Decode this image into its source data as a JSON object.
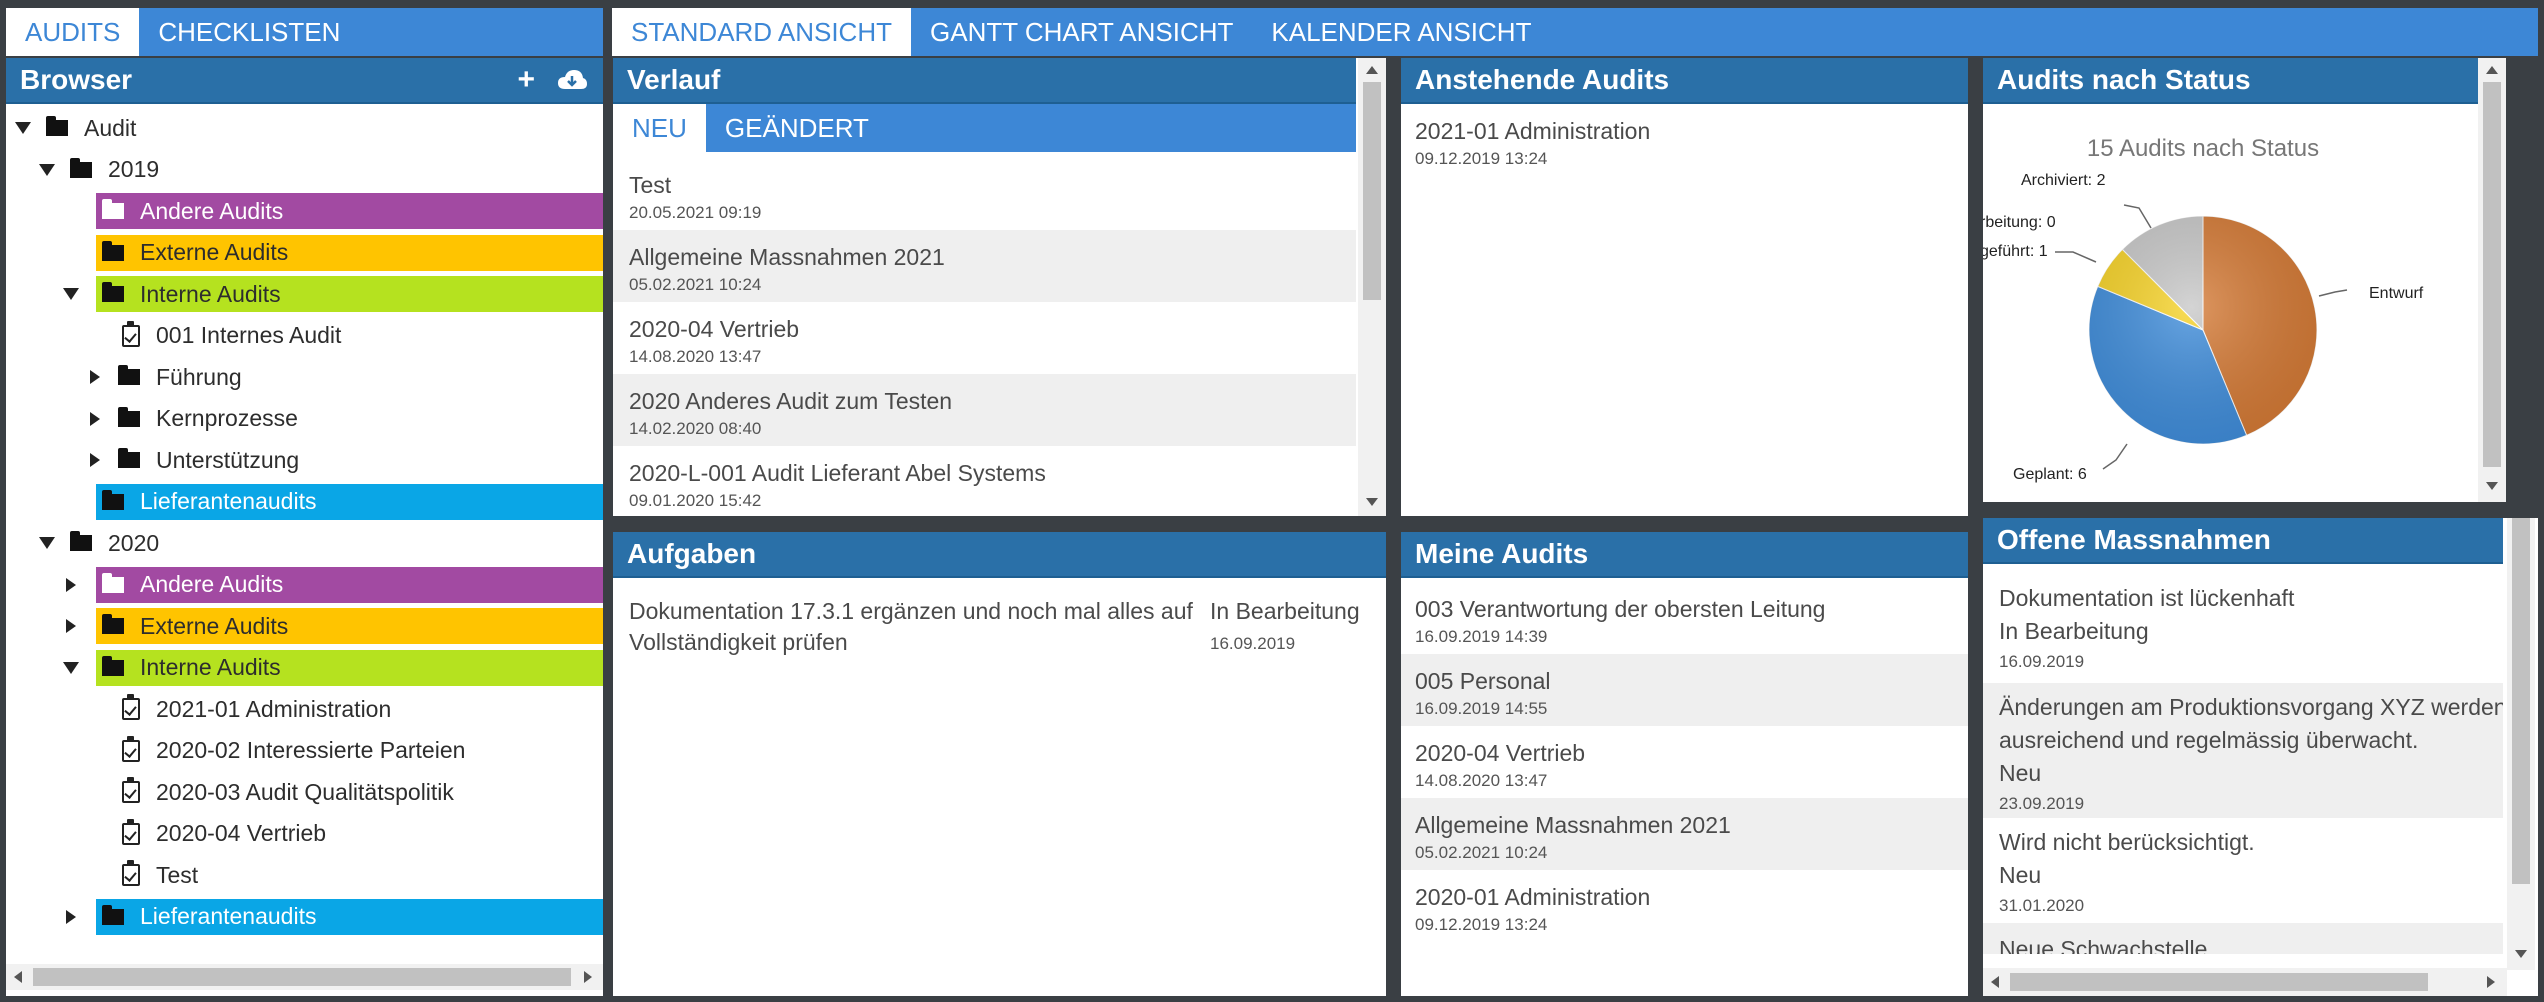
{
  "left_tabs": [
    {
      "label": "AUDITS",
      "active": true
    },
    {
      "label": "CHECKLISTEN",
      "active": false
    }
  ],
  "main_tabs": [
    {
      "label": "STANDARD ANSICHT",
      "active": true
    },
    {
      "label": "GANTT CHART ANSICHT",
      "active": false
    },
    {
      "label": "KALENDER ANSICHT",
      "active": false
    }
  ],
  "browser": {
    "title": "Browser",
    "add_icon": "+",
    "tree": [
      {
        "label": "Audit",
        "level": 0,
        "expander": "down",
        "type": "folder"
      },
      {
        "label": "2019",
        "level": 1,
        "expander": "down",
        "type": "folder"
      },
      {
        "label": "Andere Audits",
        "level": 2,
        "expander": "none",
        "type": "band",
        "color": "#a24aa2"
      },
      {
        "label": "Externe Audits",
        "level": 2,
        "expander": "none",
        "type": "band",
        "color": "#ffc400"
      },
      {
        "label": "Interne Audits",
        "level": 2,
        "expander": "down",
        "type": "band",
        "color": "#b5e21f"
      },
      {
        "label": "001 Internes Audit",
        "level": 3,
        "expander": "none",
        "type": "audit"
      },
      {
        "label": "Führung",
        "level": 3,
        "expander": "right",
        "type": "folder"
      },
      {
        "label": "Kernprozesse",
        "level": 3,
        "expander": "right",
        "type": "folder"
      },
      {
        "label": "Unterstützung",
        "level": 3,
        "expander": "right",
        "type": "folder"
      },
      {
        "label": "Lieferantenaudits",
        "level": 2,
        "expander": "none",
        "type": "band",
        "color": "#0aa6e6"
      },
      {
        "label": "2020",
        "level": 1,
        "expander": "down",
        "type": "folder"
      },
      {
        "label": "Andere Audits",
        "level": 2,
        "expander": "right",
        "type": "band",
        "color": "#a24aa2"
      },
      {
        "label": "Externe Audits",
        "level": 2,
        "expander": "right",
        "type": "band",
        "color": "#ffc400"
      },
      {
        "label": "Interne Audits",
        "level": 2,
        "expander": "down",
        "type": "band",
        "color": "#b5e21f"
      },
      {
        "label": "2021-01 Administration",
        "level": 3,
        "expander": "none",
        "type": "audit"
      },
      {
        "label": "2020-02 Interessierte Parteien",
        "level": 3,
        "expander": "none",
        "type": "audit"
      },
      {
        "label": "2020-03 Audit Qualitätspolitik",
        "level": 3,
        "expander": "none",
        "type": "audit"
      },
      {
        "label": "2020-04 Vertrieb",
        "level": 3,
        "expander": "none",
        "type": "audit"
      },
      {
        "label": "Test",
        "level": 3,
        "expander": "none",
        "type": "audit"
      },
      {
        "label": "Lieferantenaudits",
        "level": 2,
        "expander": "right",
        "type": "band",
        "color": "#0aa6e6"
      }
    ]
  },
  "verlauf": {
    "title": "Verlauf",
    "subtabs": [
      {
        "label": "NEU",
        "active": true
      },
      {
        "label": "GEÄNDERT",
        "active": false
      }
    ],
    "items": [
      {
        "title": "Test",
        "date": "20.05.2021 09:19"
      },
      {
        "title": "Allgemeine Massnahmen 2021",
        "date": "05.02.2021 10:24"
      },
      {
        "title": "2020-04 Vertrieb",
        "date": "14.08.2020 13:47"
      },
      {
        "title": "2020 Anderes Audit zum Testen",
        "date": "14.02.2020 08:40"
      },
      {
        "title": "2020-L-001 Audit Lieferant Abel Systems",
        "date": "09.01.2020 15:42"
      }
    ]
  },
  "anstehende": {
    "title": "Anstehende Audits",
    "items": [
      {
        "title": "2021-01 Administration",
        "date": "09.12.2019 13:24"
      }
    ]
  },
  "status_chart": {
    "title": "Audits nach Status"
  },
  "chart_data": {
    "type": "pie",
    "title": "15 Audits nach Status",
    "slices": [
      {
        "label": "Entwurf",
        "value": 7,
        "color": "#d57a35"
      },
      {
        "label": "Geplant",
        "value": 6,
        "color": "#3f8ddb"
      },
      {
        "label": "Durchgeführt",
        "value": 1,
        "color": "#f7d327"
      },
      {
        "label": "In Bearbeitung",
        "value": 0,
        "color": "#6ab04c"
      },
      {
        "label": "Archiviert",
        "value": 2,
        "color": "#c8c8c8"
      }
    ],
    "visible_labels": {
      "entwurf": "Entwurf",
      "geplant": "Geplant: 6",
      "durchgefuehrt": "geführt: 1",
      "bearbeitung": "rbeitung: 0",
      "archiviert": "Archiviert: 2"
    }
  },
  "aufgaben": {
    "title": "Aufgaben",
    "items": [
      {
        "title_line1": "Dokumentation 17.3.1 ergänzen und noch mal alles auf",
        "title_line2": "Vollständigkeit prüfen",
        "status": "In Bearbeitung",
        "date": "16.09.2019"
      }
    ]
  },
  "meine": {
    "title": "Meine Audits",
    "items": [
      {
        "title": "003 Verantwortung der obersten Leitung",
        "date": "16.09.2019 14:39"
      },
      {
        "title": "005 Personal",
        "date": "16.09.2019 14:55"
      },
      {
        "title": "2020-04 Vertrieb",
        "date": "14.08.2020 13:47"
      },
      {
        "title": "Allgemeine Massnahmen 2021",
        "date": "05.02.2021 10:24"
      },
      {
        "title": "2020-01 Administration",
        "date": "09.12.2019 13:24"
      }
    ]
  },
  "offene": {
    "title": "Offene Massnahmen",
    "items": [
      {
        "line1": "Dokumentation ist lückenhaft",
        "line2": "",
        "status": "In Bearbeitung",
        "date": "16.09.2019"
      },
      {
        "line1": "Änderungen am Produktionsvorgang XYZ werden",
        "line2": "ausreichend und regelmässig überwacht.",
        "status": "Neu",
        "date": "23.09.2019"
      },
      {
        "line1": "Wird nicht berücksichtigt.",
        "line2": "",
        "status": "Neu",
        "date": "31.01.2020"
      },
      {
        "line1": "Neue Schwachstelle",
        "line2": "",
        "status": "",
        "date": ""
      }
    ]
  },
  "colors": {
    "tabbar": "#3d87d6",
    "panel_header": "#2a70a8",
    "background": "#3a3f44"
  }
}
